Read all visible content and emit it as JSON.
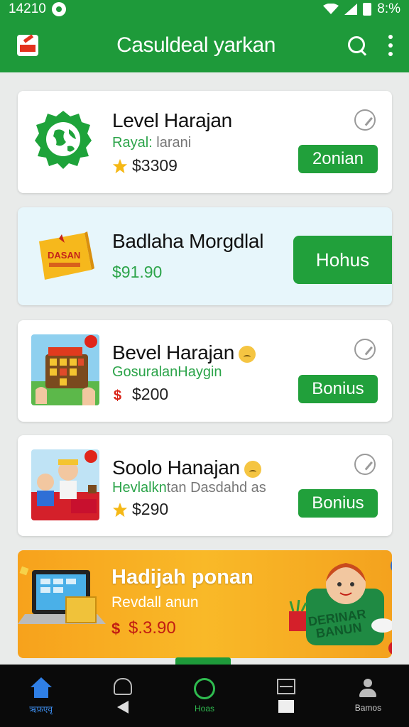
{
  "status_bar": {
    "time": "14210",
    "battery": "8:%"
  },
  "app_bar": {
    "title": "Casuldeal yarkan"
  },
  "cards": [
    {
      "title": "Level Harajan",
      "subtitle_green": "Rayal:",
      "subtitle_grey": "larani",
      "price": "$3309",
      "button": "2onian"
    },
    {
      "title": "Badlaha Morgdlal",
      "price": "$91.90",
      "button": "Hohus",
      "thumb_text": "DASAN"
    },
    {
      "title": "Bevel Harajan",
      "subtitle_green": "GosuralanHaygin",
      "price": "$200",
      "button": "Bonius"
    },
    {
      "title": "Soolo Hanajan",
      "subtitle_green": "Hevlalkn",
      "subtitle_grey": "tan Dasdahd as",
      "price": "$290",
      "button": "Bonius"
    }
  ],
  "promo": {
    "title": "Hadijah ponan",
    "subtitle": "Revdall anun",
    "price": "$.3.90",
    "badge": "DERINAR BANUN"
  },
  "bottom_nav": [
    {
      "label": "ऋफ़एवृ"
    },
    {
      "label": ""
    },
    {
      "label": "Hoas"
    },
    {
      "label": ""
    },
    {
      "label": "Bamos"
    }
  ],
  "colors": {
    "primary": "#1e9a3a",
    "accent_button": "#21a03b",
    "promo": "#f9b928"
  }
}
